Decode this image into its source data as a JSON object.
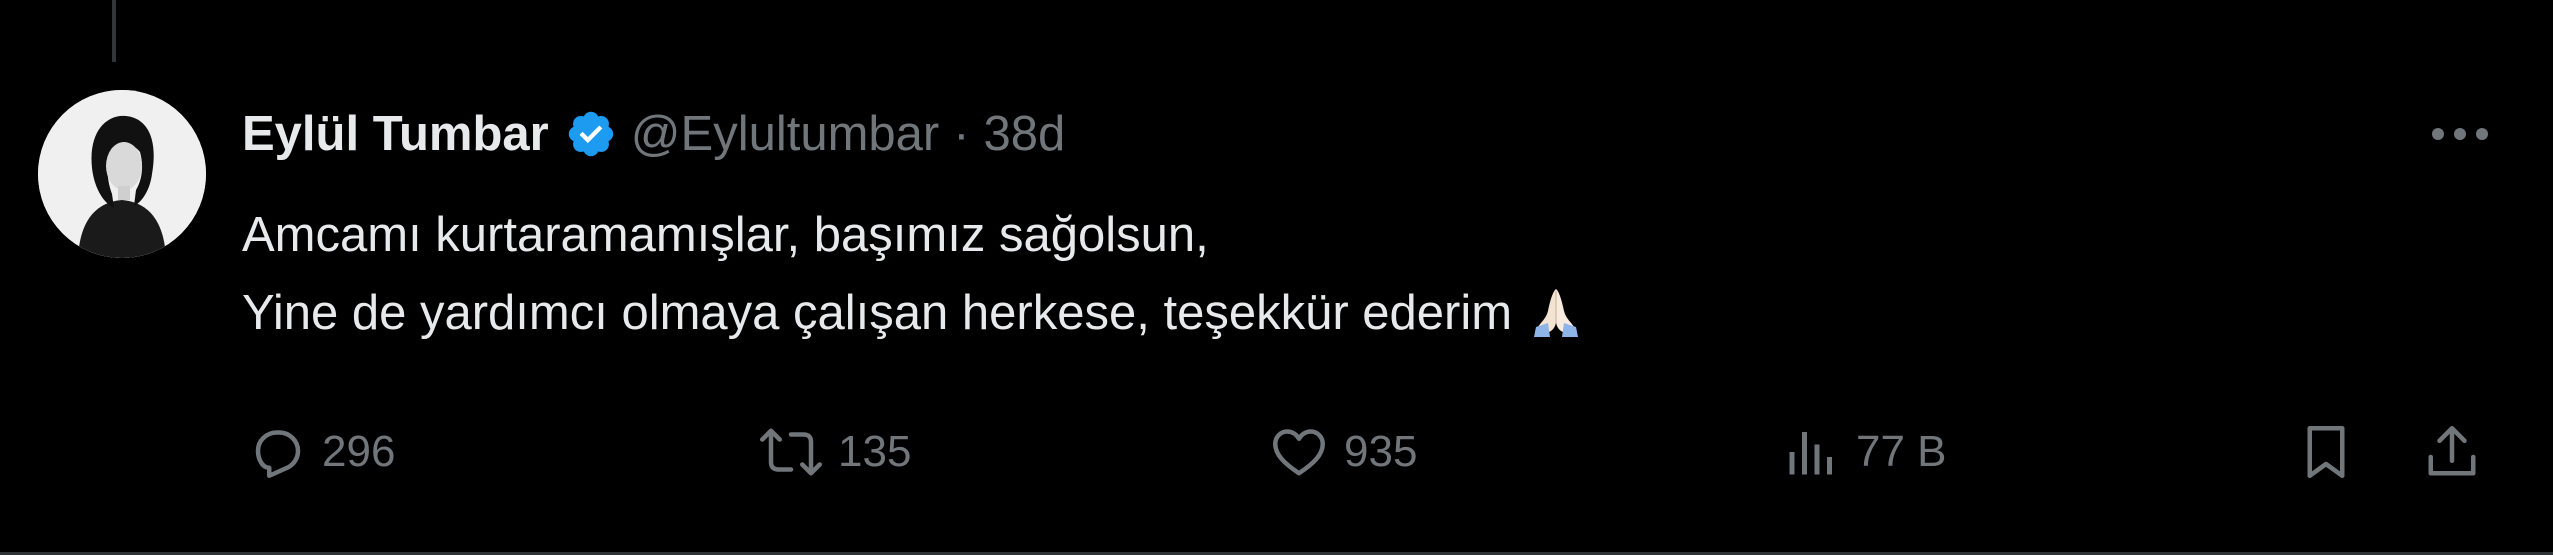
{
  "tweet": {
    "author": {
      "display_name": "Eylül Tumbar",
      "handle": "@Eylultumbar",
      "verified": true,
      "avatar_icon": "avatar-photo"
    },
    "separator": "·",
    "timestamp": "38d",
    "text_lines": [
      "Amcamı kurtaramamışlar, başımız sağolsun,",
      "Yine de yardımcı olmaya çalışan herkese, teşekkür ederim"
    ],
    "text_emoji": "folded-hands-icon",
    "actions": {
      "replies": {
        "icon": "reply-icon",
        "count": "296"
      },
      "retweets": {
        "icon": "retweet-icon",
        "count": "135"
      },
      "likes": {
        "icon": "heart-icon",
        "count": "935"
      },
      "views": {
        "icon": "views-icon",
        "count": "77 B"
      },
      "bookmark": {
        "icon": "bookmark-icon"
      },
      "share": {
        "icon": "share-icon"
      }
    },
    "more_icon": "more-icon"
  },
  "colors": {
    "background": "#000000",
    "primary_text": "#e7e9ea",
    "secondary_text": "#71767b",
    "verified_blue": "#1d9bf0",
    "divider": "#2f3336"
  }
}
